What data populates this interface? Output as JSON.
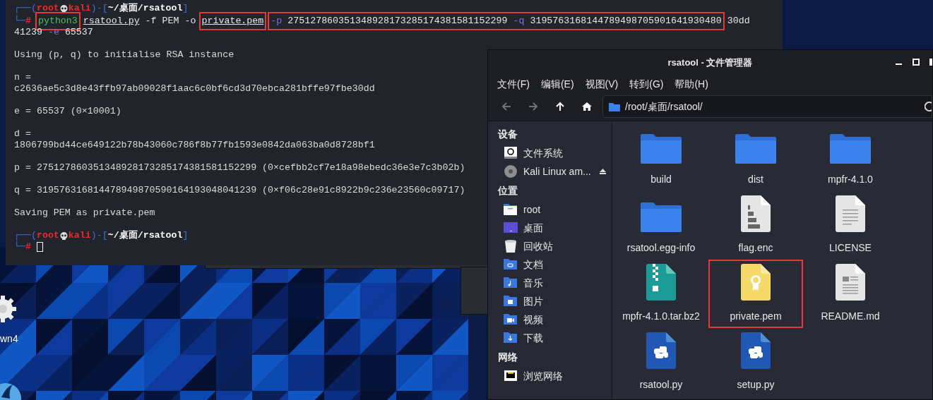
{
  "desktop": {
    "icons": [
      {
        "kind": "gear",
        "label": "wn4"
      },
      {
        "kind": "fin"
      }
    ]
  },
  "terminal": {
    "lines": [
      {
        "kind": "prompt",
        "open": "┌──(",
        "user": "root",
        "host": "kali",
        "mid": ")-[",
        "path": "~/桌面/rsatool",
        "close": "]"
      },
      {
        "kind": "input",
        "prefix": "└─",
        "symbol": "#",
        "groups": [
          {
            "boxed": true,
            "tokens": [
              {
                "kind": "cmd",
                "text": "python3"
              }
            ]
          },
          {
            "boxed": false,
            "tokens": [
              {
                "kind": "file",
                "text": "rsatool.py"
              },
              {
                "kind": "arg",
                "text": "-f"
              },
              {
                "kind": "arg",
                "text": "PEM"
              },
              {
                "kind": "arg",
                "text": "-o"
              }
            ]
          },
          {
            "boxed": true,
            "tokens": [
              {
                "kind": "file",
                "text": "private.pem"
              }
            ]
          },
          {
            "boxed": true,
            "tokens": [
              {
                "kind": "flag",
                "text": "-p"
              },
              {
                "kind": "arg",
                "text": "275127860351348928173285174381581152299"
              },
              {
                "kind": "flag",
                "text": "-q"
              },
              {
                "kind": "arg",
                "text": "3195763168144789498705901641930480"
              }
            ]
          },
          {
            "boxed": false,
            "tokens": [
              {
                "kind": "arg",
                "text": "30dd"
              }
            ]
          }
        ]
      },
      {
        "kind": "input",
        "groups": [
          {
            "boxed": false,
            "tokens": [
              {
                "kind": "arg",
                "text": "41239"
              },
              {
                "kind": "flag",
                "text": "-e"
              },
              {
                "kind": "arg",
                "text": "65537"
              }
            ]
          }
        ]
      },
      {
        "kind": "blank"
      },
      {
        "kind": "output",
        "text": "Using (p, q) to initialise RSA instance"
      },
      {
        "kind": "blank"
      },
      {
        "kind": "output",
        "text": "n ="
      },
      {
        "kind": "output",
        "text": "c2636ae5c3d8e43ffb97ab09028f1aac6c0bf6cd3d70ebca281bffe97fbe30dd"
      },
      {
        "kind": "blank"
      },
      {
        "kind": "output",
        "text": "e = 65537 (0×10001)"
      },
      {
        "kind": "blank"
      },
      {
        "kind": "output",
        "text": "d ="
      },
      {
        "kind": "output",
        "text": "1806799bd44ce649122b78b43060c786f8b77fb1593e0842da063ba0d8728bf1"
      },
      {
        "kind": "blank"
      },
      {
        "kind": "output",
        "text": "p = 275127860351348928173285174381581152299 (0×cefbb2cf7e18a98ebedc36e3e7c3b02b)"
      },
      {
        "kind": "blank"
      },
      {
        "kind": "output",
        "text": "q = 319576316814478949870590164193048041239 (0×f06c28e91c8922b9c236e23560c09717)"
      },
      {
        "kind": "blank"
      },
      {
        "kind": "output",
        "text": "Saving PEM as private.pem"
      },
      {
        "kind": "blank"
      },
      {
        "kind": "prompt",
        "open": "┌──(",
        "user": "root",
        "host": "kali",
        "mid": ")-[",
        "path": "~/桌面/rsatool",
        "close": "]"
      },
      {
        "kind": "input",
        "prefix": "└─",
        "symbol": "#",
        "cursor": true
      }
    ]
  },
  "file_manager": {
    "title": "rsatool - 文件管理器",
    "menu": [
      "文件(F)",
      "编辑(E)",
      "视图(V)",
      "转到(G)",
      "帮助(H)"
    ],
    "nav": [
      {
        "kind": "back",
        "disabled": true
      },
      {
        "kind": "forward",
        "disabled": true
      },
      {
        "kind": "up",
        "disabled": false
      },
      {
        "kind": "home",
        "disabled": false
      }
    ],
    "address": "/root/桌面/rsatool/",
    "sidebar": [
      {
        "header": "设备",
        "items": [
          {
            "kind": "drive",
            "label": "文件系统",
            "eject": false
          },
          {
            "kind": "disc",
            "label": "Kali Linux am...",
            "eject": true
          }
        ]
      },
      {
        "header": "位置",
        "items": [
          {
            "kind": "home",
            "label": "root",
            "eject": false
          },
          {
            "kind": "desktop",
            "label": "桌面",
            "eject": false
          },
          {
            "kind": "trash",
            "label": "回收站",
            "eject": false
          },
          {
            "kind": "documents",
            "label": "文档",
            "eject": false
          },
          {
            "kind": "music",
            "label": "音乐",
            "eject": false
          },
          {
            "kind": "pictures",
            "label": "图片",
            "eject": false
          },
          {
            "kind": "videos",
            "label": "视频",
            "eject": false
          },
          {
            "kind": "downloads",
            "label": "下载",
            "eject": false
          }
        ]
      },
      {
        "header": "网络",
        "items": [
          {
            "kind": "network",
            "label": "浏览网络",
            "eject": false
          }
        ]
      }
    ],
    "files": [
      {
        "kind": "folder",
        "name": "build",
        "boxed": false
      },
      {
        "kind": "folder",
        "name": "dist",
        "boxed": false
      },
      {
        "kind": "folder",
        "name": "mpfr-4.1.0",
        "boxed": false
      },
      {
        "kind": "folder",
        "name": "rsatool.egg-info",
        "boxed": false
      },
      {
        "kind": "binary",
        "name": "flag.enc",
        "boxed": false
      },
      {
        "kind": "text",
        "name": "LICENSE",
        "boxed": false
      },
      {
        "kind": "archive",
        "name": "mpfr-4.1.0.tar.bz2",
        "boxed": false
      },
      {
        "kind": "certificate",
        "name": "private.pem",
        "boxed": true
      },
      {
        "kind": "document",
        "name": "README.md",
        "boxed": false
      },
      {
        "kind": "python",
        "name": "rsatool.py",
        "boxed": false
      },
      {
        "kind": "python",
        "name": "setup.py",
        "boxed": false
      }
    ]
  }
}
